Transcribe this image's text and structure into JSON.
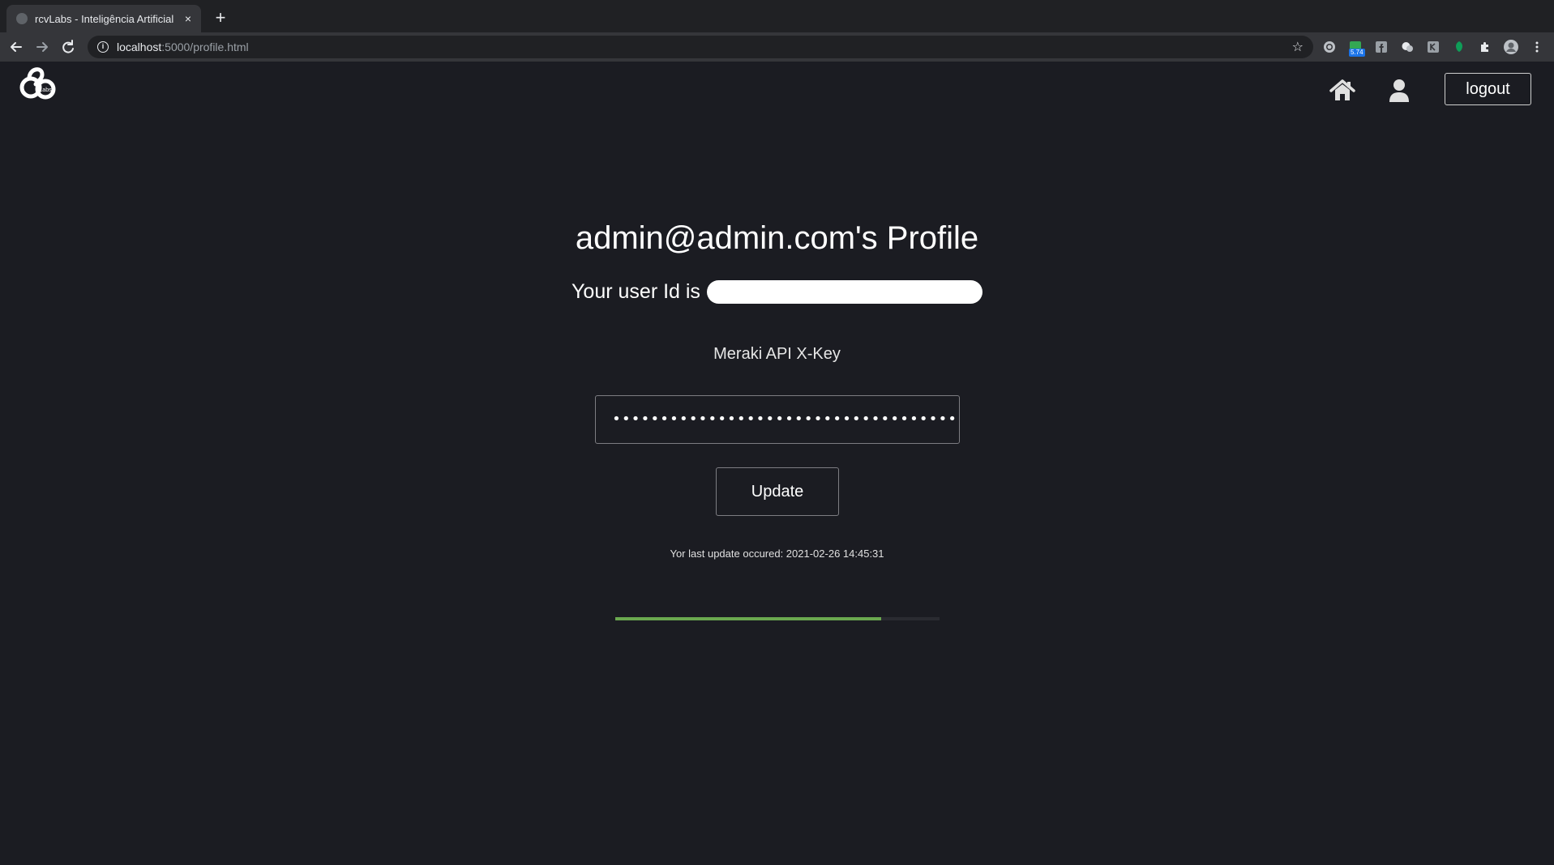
{
  "browser": {
    "tab_title": "rcvLabs - Inteligência Artificial",
    "tab_close": "×",
    "new_tab": "+",
    "url_host": "localhost",
    "url_rest": ":5000/profile.html",
    "info": "i",
    "star": "☆",
    "ext_badge": "5.74"
  },
  "header": {
    "logo_text": "Labs",
    "logout_label": "logout"
  },
  "profile": {
    "title": "admin@admin.com's Profile",
    "userid_label": "Your user Id is"
  },
  "form": {
    "api_label": "Meraki API X-Key",
    "api_value": "•••••••••••••••••••••••••••••••••••••••••",
    "update_label": "Update",
    "last_update": "Yor last update occured: 2021-02-26 14:45:31"
  },
  "progress": {
    "fraction": 0.82,
    "color": "#6aa84f"
  }
}
